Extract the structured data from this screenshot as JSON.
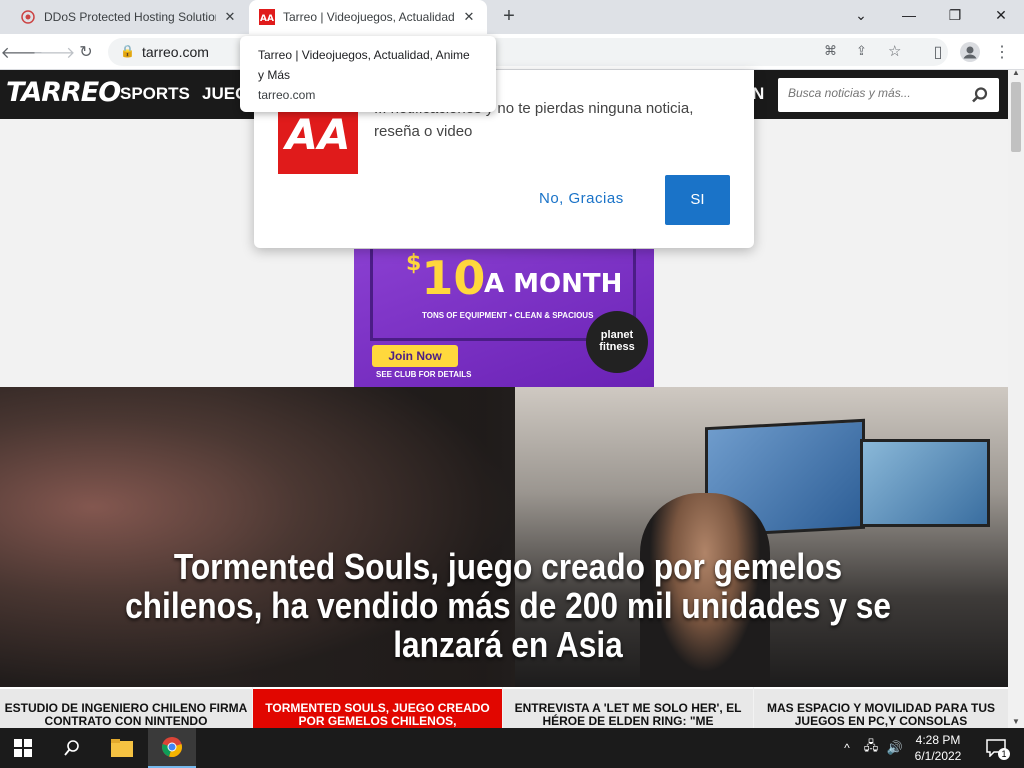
{
  "browser": {
    "tabs": [
      {
        "title": "DDoS Protected Hosting Solution",
        "active": false
      },
      {
        "title": "Tarreo | Videojuegos, Actualidad",
        "active": true
      }
    ],
    "url": "tarreo.com",
    "tooltip": {
      "title": "Tarreo | Videojuegos, Actualidad, Anime y Más",
      "url": "tarreo.com"
    }
  },
  "site": {
    "logo": "TARREO",
    "nav": [
      "SPORTS",
      "JUEG",
      "N"
    ],
    "search_placeholder": "Busca noticias y más...",
    "accent": "#e10600"
  },
  "popup": {
    "text": "... notificaciones y no te pierdas ninguna noticia, reseña o video",
    "no_label": "No, Gracias",
    "yes_label": "SI"
  },
  "ad": {
    "price": "10",
    "price_symbol": "$",
    "per": "A MONTH",
    "tagline": "TONS OF EQUIPMENT • CLEAN & SPACIOUS",
    "cta": "Join Now",
    "fine_print": "SEE CLUB FOR DETAILS",
    "brand": "planet fitness"
  },
  "hero": {
    "title": "Tormented Souls, juego creado por gemelos chilenos, ha vendido más de 200 mil unidades y se lanzará en Asia"
  },
  "articles": [
    {
      "title": "ESTUDIO DE INGENIERO CHILENO FIRMA CONTRATO CON NINTENDO",
      "active": false
    },
    {
      "title": "TORMENTED SOULS, JUEGO CREADO POR GEMELOS CHILENOS,",
      "active": true
    },
    {
      "title": "ENTREVISTA A 'LET ME SOLO HER', EL HÉROE DE ELDEN RING: \"ME",
      "active": false
    },
    {
      "title": "MAS ESPACIO Y MOVILIDAD PARA TUS JUEGOS EN PC,Y CONSOLAS",
      "active": false
    }
  ],
  "taskbar": {
    "time": "4:28 PM",
    "date": "6/1/2022",
    "notification_count": "1"
  }
}
